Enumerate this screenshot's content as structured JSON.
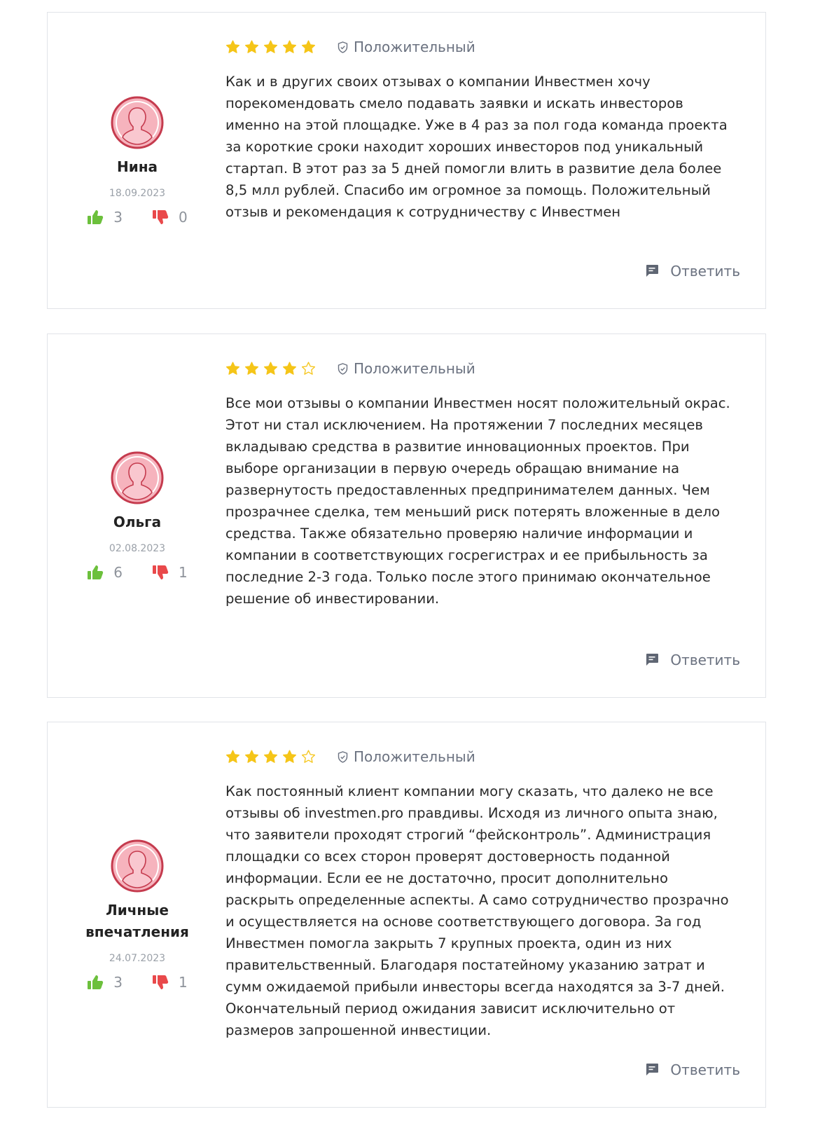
{
  "colors": {
    "star": "#f5c518",
    "thumb_up": "#6cc03c",
    "thumb_down": "#e9494b",
    "avatar_ring": "#c53b4e",
    "avatar_fill": "#f6b3bd",
    "muted": "#6b7280"
  },
  "icons": {
    "avatar": "user-avatar-icon",
    "like": "thumbs-up-icon",
    "dislike": "thumbs-down-icon",
    "sentiment": "shield-check-icon",
    "reply": "comment-icon",
    "star_full": "star-filled-icon",
    "star_empty": "star-outline-icon"
  },
  "reviews": [
    {
      "author": "Нина",
      "date": "18.09.2023",
      "likes": "3",
      "dislikes": "0",
      "rating": 5,
      "sentiment": "Положительный",
      "text": "Как и в других своих отзывах о компании Инвестмен хочу порекомендовать смело подавать заявки и искать инвесторов именно на этой площадке. Уже в 4 раз за пол года команда проекта за короткие сроки находит хороших инвесторов под уникальный стартап. В этот раз за 5 дней помогли влить в развитие дела более 8,5 млл рублей. Спасибо им огромное за помощь. Положительный отзыв и рекомендация к сотрудничеству с Инвестмен",
      "reply_label": "Ответить"
    },
    {
      "author": "Ольга",
      "date": "02.08.2023",
      "likes": "6",
      "dislikes": "1",
      "rating": 4,
      "sentiment": "Положительный",
      "text": "Все мои отзывы о компании Инвестмен носят положительный окрас. Этот ни стал исключением. На протяжении 7 последних месяцев вкладываю средства в развитие инновационных проектов. При выборе организации в первую очередь обращаю внимание на развернутость предоставленных предпринимателем данных. Чем прозрачнее сделка, тем меньший риск потерять вложенные в дело средства. Также обязательно проверяю наличие информации и компании в соответствующих госрегистрах и ее прибыльность за последние 2-3 года. Только после этого принимаю окончательное решение об инвестировании.",
      "reply_label": "Ответить"
    },
    {
      "author": "Личные впечатления",
      "date": "24.07.2023",
      "likes": "3",
      "dislikes": "1",
      "rating": 4,
      "sentiment": "Положительный",
      "text": "Как постоянный клиент компании могу сказать, что далеко не все отзывы об investmen.pro правдивы. Исходя из личного опыта знаю, что заявители проходят строгий “фейсконтроль”. Администрация площадки со всех сторон проверят достоверность поданной информации. Если ее не достаточно, просит дополнительно раскрыть определенные аспекты. А само сотрудничество прозрачно и осуществляется на основе соответствующего договора. За год Инвестмен помогла закрыть 7 крупных проекта, один из них правительственный. Благодаря постатейному указанию затрат и сумм ожидаемой прибыли инвесторы всегда находятся за 3-7 дней. Окончательный период ожидания зависит исключительно от размеров запрошенной инвестиции.",
      "reply_label": "Ответить"
    }
  ]
}
